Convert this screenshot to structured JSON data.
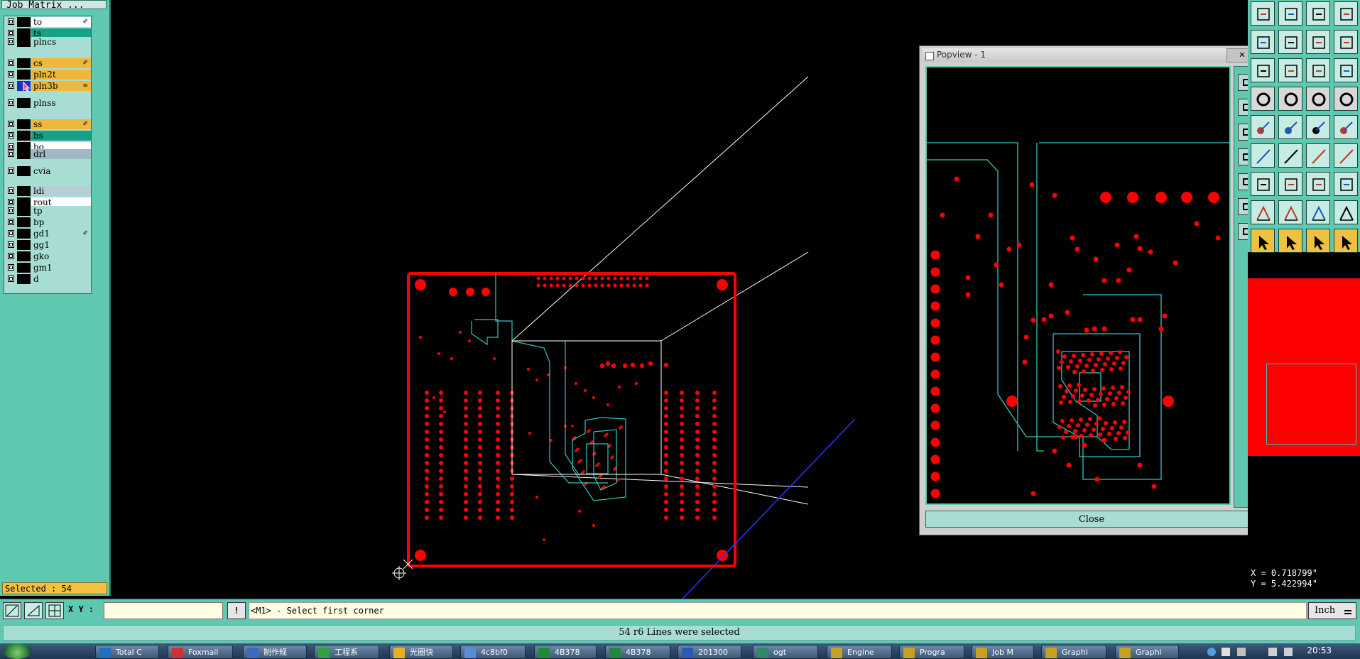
{
  "job_matrix": {
    "title": "Job Matrix ...",
    "layers": [
      {
        "name": "to",
        "color": "#ffffff",
        "flag": "✐"
      },
      {
        "name": "ts",
        "color": "#16a085",
        "flag": ""
      },
      {
        "name": "plncs",
        "color": "#a7ddd2",
        "flag": ""
      },
      {
        "name": "cs",
        "color": "#f0b83a",
        "flag": "✐"
      },
      {
        "name": "pln2t",
        "color": "#f0b83a",
        "flag": ""
      },
      {
        "name": "pln3b",
        "color": "#f0b83a",
        "flag": "≡"
      },
      {
        "name": "plnss",
        "color": "#a7ddd2",
        "flag": ""
      },
      {
        "name": "ss",
        "color": "#f0b83a",
        "flag": "✐"
      },
      {
        "name": "bs",
        "color": "#16a085",
        "flag": ""
      },
      {
        "name": "bo",
        "color": "#ffffff",
        "flag": ""
      },
      {
        "name": "drl",
        "color": "#a0b8c4",
        "flag": ""
      },
      {
        "name": "cvia",
        "color": "#a7ddd2",
        "flag": ""
      },
      {
        "name": "ldi",
        "color": "#b8cdd6",
        "flag": ""
      },
      {
        "name": "rout",
        "color": "#ffffff",
        "flag": ""
      },
      {
        "name": "tp",
        "color": "#a7ddd2",
        "flag": ""
      },
      {
        "name": "bp",
        "color": "#a7ddd2",
        "flag": ""
      },
      {
        "name": "gd1",
        "color": "#a7ddd2",
        "flag": "✐"
      },
      {
        "name": "gg1",
        "color": "#a7ddd2",
        "flag": ""
      },
      {
        "name": "gko",
        "color": "#a7ddd2",
        "flag": ""
      },
      {
        "name": "gm1",
        "color": "#a7ddd2",
        "flag": ""
      },
      {
        "name": "d",
        "color": "#a7ddd2",
        "flag": ""
      }
    ],
    "selected_status": "Selected : 54"
  },
  "popview": {
    "title": "Popview - 1",
    "close_x": "✕",
    "close_label": "Close"
  },
  "coordinates": {
    "x": "X = 0.718799\"",
    "y": "Y = 5.422994\""
  },
  "command_bar": {
    "xy_label": "X Y :",
    "xy_value": "",
    "excl_label": "!",
    "prompt": "<M1> - Select first corner",
    "units": "Inch"
  },
  "message": "54 r6 Lines were selected",
  "taskbar": {
    "items": [
      {
        "label": "Total C",
        "color": "#1f6ec8"
      },
      {
        "label": "Foxmail",
        "color": "#d03030"
      },
      {
        "label": "制作规",
        "color": "#3a6ac8"
      },
      {
        "label": "工程系",
        "color": "#30a040"
      },
      {
        "label": "光圈快",
        "color": "#e8b020"
      },
      {
        "label": "4c8bf0",
        "color": "#5a8ad8"
      },
      {
        "label": "4B378",
        "color": "#1f8a3a"
      },
      {
        "label": "4B378",
        "color": "#1f8a3a"
      },
      {
        "label": "201300",
        "color": "#2a5ab8"
      },
      {
        "label": "ogt",
        "color": "#2a8a6a"
      },
      {
        "label": "Engine",
        "color": "#c8a020"
      },
      {
        "label": "Progra",
        "color": "#c8a020"
      },
      {
        "label": "Job M",
        "color": "#c8a020"
      },
      {
        "label": "Graphi",
        "color": "#c8a020"
      },
      {
        "label": "Graphi",
        "color": "#c8a020"
      }
    ],
    "clock": "20:53"
  },
  "colors": {
    "panel": "#5ec8b0",
    "copper": "#ff0000",
    "trace": "#30c8c0",
    "input_bg": "#fffde4"
  }
}
